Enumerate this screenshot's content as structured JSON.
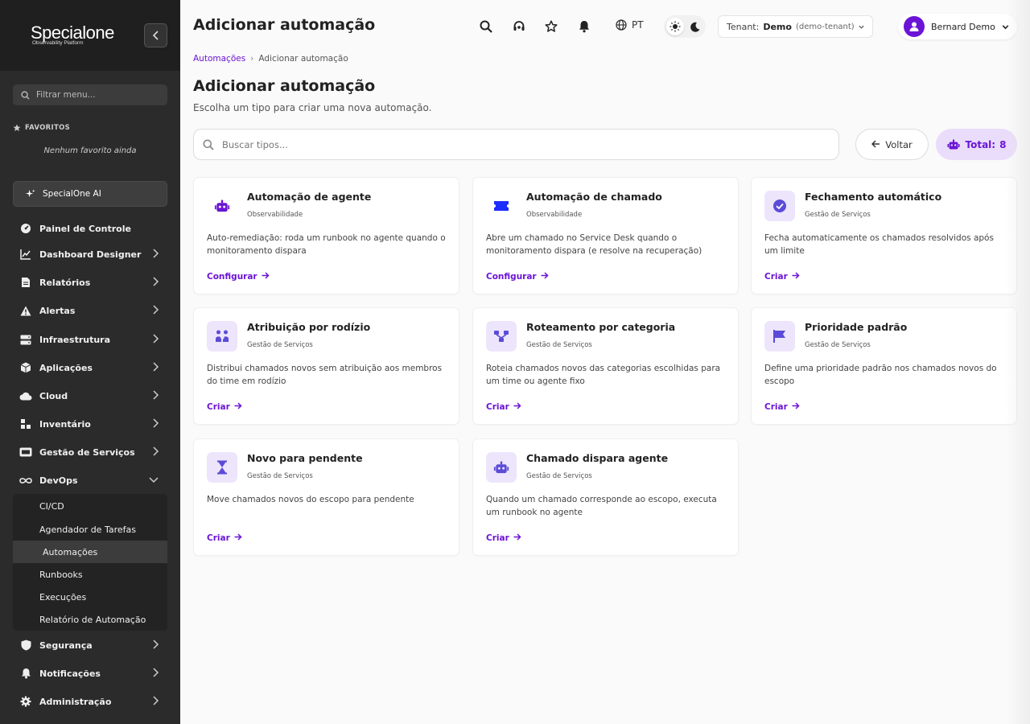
{
  "brand": {
    "name": "Specialone",
    "subtitle": "Observability Platform"
  },
  "sidebar": {
    "filter_placeholder": "Filtrar menu...",
    "favorites_title": "FAVORITOS",
    "favorites_empty": "Nenhum favorito ainda",
    "ai_label": "SpecialOne AI",
    "items": [
      {
        "label": "Painel de Controle",
        "icon": "gauge-icon",
        "has_children": false
      },
      {
        "label": "Dashboard Designer",
        "icon": "chart-line-icon",
        "has_children": true
      },
      {
        "label": "Relatórios",
        "icon": "report-icon",
        "has_children": true
      },
      {
        "label": "Alertas",
        "icon": "warning-icon",
        "has_children": true
      },
      {
        "label": "Infraestrutura",
        "icon": "server-icon",
        "has_children": true
      },
      {
        "label": "Aplicações",
        "icon": "box-icon",
        "has_children": true
      },
      {
        "label": "Cloud",
        "icon": "cloud-icon",
        "has_children": true
      },
      {
        "label": "Inventário",
        "icon": "boxes-icon",
        "has_children": true
      },
      {
        "label": "Gestão de Serviços",
        "icon": "ticket-icon",
        "has_children": true
      },
      {
        "label": "DevOps",
        "icon": "infinity-icon",
        "has_children": true,
        "expanded": true
      },
      {
        "label": "Segurança",
        "icon": "shield-icon",
        "has_children": true
      },
      {
        "label": "Notificações",
        "icon": "bell-icon",
        "has_children": true
      },
      {
        "label": "Administração",
        "icon": "gear-icon",
        "has_children": true
      }
    ],
    "devops_children": [
      {
        "label": "CI/CD",
        "active": false
      },
      {
        "label": "Agendador de Tarefas",
        "active": false
      },
      {
        "label": "Automações",
        "active": true
      },
      {
        "label": "Runbooks",
        "active": false
      },
      {
        "label": "Execuções",
        "active": false
      },
      {
        "label": "Relatório de Automação",
        "active": false
      }
    ]
  },
  "header": {
    "title": "Adicionar automação",
    "language": "PT",
    "tenant_label": "Tenant:",
    "tenant_name": "Demo",
    "tenant_slug": "(demo-tenant)",
    "user_name": "Bernard Demo"
  },
  "breadcrumb": {
    "parent": "Automações",
    "separator": "›",
    "current": "Adicionar automação"
  },
  "page": {
    "title": "Adicionar automação",
    "subtitle": "Escolha um tipo para criar uma nova automação.",
    "search_placeholder": "Buscar tipos...",
    "back_label": "Voltar",
    "total_label": "Total:",
    "total_value": "8"
  },
  "cards": [
    {
      "title": "Automação de agente",
      "category": "Observabilidade",
      "description": "Auto-remediação: roda um runbook no agente quando o monitoramento dispara",
      "action": "Configurar",
      "icon": "robot-icon"
    },
    {
      "title": "Automação de chamado",
      "category": "Observabilidade",
      "description": "Abre um chamado no Service Desk quando o monitoramento dispara (e resolve na recuperação)",
      "action": "Configurar",
      "icon": "ticket-icon"
    },
    {
      "title": "Fechamento automático",
      "category": "Gestão de Serviços",
      "description": "Fecha automaticamente os chamados resolvidos após um limite",
      "action": "Criar",
      "icon": "check-circle-icon"
    },
    {
      "title": "Atribuição por rodízio",
      "category": "Gestão de Serviços",
      "description": "Distribui chamados novos sem atribuição aos membros do time em rodízio",
      "action": "Criar",
      "icon": "people-rotate-icon"
    },
    {
      "title": "Roteamento por categoria",
      "category": "Gestão de Serviços",
      "description": "Roteia chamados novos das categorias escolhidas para um time ou agente fixo",
      "action": "Criar",
      "icon": "routing-icon"
    },
    {
      "title": "Prioridade padrão",
      "category": "Gestão de Serviços",
      "description": "Define uma prioridade padrão nos chamados novos do escopo",
      "action": "Criar",
      "icon": "flag-icon"
    },
    {
      "title": "Novo para pendente",
      "category": "Gestão de Serviços",
      "description": "Move chamados novos do escopo para pendente",
      "action": "Criar",
      "icon": "hourglass-icon"
    },
    {
      "title": "Chamado dispara agente",
      "category": "Gestão de Serviços",
      "description": "Quando um chamado corresponde ao escopo, executa um runbook no agente",
      "action": "Criar",
      "icon": "robot-icon"
    }
  ],
  "colors": {
    "accent": "#6b14d6",
    "sidebar_bg": "#2b2b2b",
    "icon_bg": "#ede5fb"
  }
}
